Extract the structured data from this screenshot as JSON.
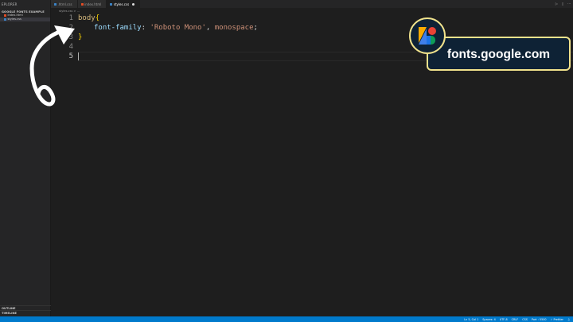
{
  "sidebar": {
    "title": "EPLORER",
    "section": "GOOGLE FONTS EXAMPLE",
    "files": [
      {
        "name": "index.html",
        "type": "html",
        "active": false
      },
      {
        "name": "styles.css",
        "type": "css",
        "active": true
      }
    ],
    "outline_label": "OUTLINE",
    "timeline_label": "TIMELINE"
  },
  "tabs": [
    {
      "label": ".html.css",
      "type": "css",
      "active": false
    },
    {
      "label": "index.html",
      "type": "html",
      "active": false
    },
    {
      "label": "styles.css",
      "type": "css",
      "active": true
    }
  ],
  "breadcrumb": "styles.css  >  ...",
  "editor": {
    "line_numbers": [
      "1",
      "2",
      "3",
      "4",
      "5"
    ],
    "line1_selector": "body",
    "line1_brace": "{",
    "line2_property": "font-family",
    "line2_colon": ": ",
    "line2_string": "'Roboto Mono'",
    "line2_comma": ", ",
    "line2_value": "monospace",
    "line2_semicolon": ";",
    "line3_brace": "}"
  },
  "status_bar": {
    "items": [
      "Ln 5, Col 1",
      "Spaces: 4",
      "UTF-8",
      "CRLF",
      "CSS",
      "Port : 5500",
      "✓ Prettier"
    ]
  },
  "overlay": {
    "badge_text": "fonts.google.com",
    "logo_icon": "google-fonts-logo",
    "arrow_icon": "curved-arrow-icon"
  },
  "colors": {
    "accent": "#007acc",
    "badge_bg": "#0e2235",
    "badge_border": "#f0e28c"
  }
}
